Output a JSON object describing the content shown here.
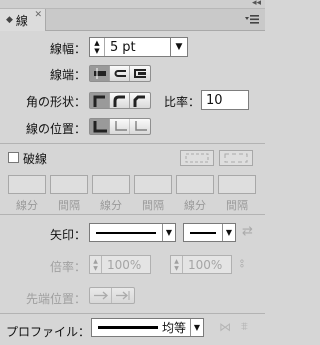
{
  "panel": {
    "tab_label": "線",
    "tab_icon": "stroke-icon",
    "collapse_glyph": "◂◂",
    "close_glyph": "✕"
  },
  "weight": {
    "label": "線幅：",
    "value": "5",
    "unit": "pt"
  },
  "cap": {
    "label": "線端：",
    "buttons": [
      "butt-cap",
      "round-cap",
      "projecting-cap"
    ],
    "selected": 0
  },
  "corner": {
    "label": "角の形状：",
    "buttons": [
      "miter-join",
      "round-join",
      "bevel-join"
    ],
    "selected": 0,
    "limit_label": "比率：",
    "limit_value": "10"
  },
  "align": {
    "label": "線の位置：",
    "buttons": [
      "align-center",
      "align-inside",
      "align-outside"
    ],
    "selected": 0
  },
  "dashed": {
    "label": "破線",
    "checked": false,
    "fields": [
      {
        "type": "線分"
      },
      {
        "type": "間隔"
      },
      {
        "type": "線分"
      },
      {
        "type": "間隔"
      },
      {
        "type": "線分"
      },
      {
        "type": "間隔"
      }
    ]
  },
  "arrow": {
    "label": "矢印：",
    "scale_label": "倍率：",
    "scale_start": "100%",
    "scale_end": "100%",
    "align_label": "先端位置："
  },
  "profile": {
    "label": "プロファイル：",
    "value": "均等"
  },
  "colors": {
    "panel_bg": "#d6d6d6",
    "selected_button": "#9a9a9a"
  }
}
